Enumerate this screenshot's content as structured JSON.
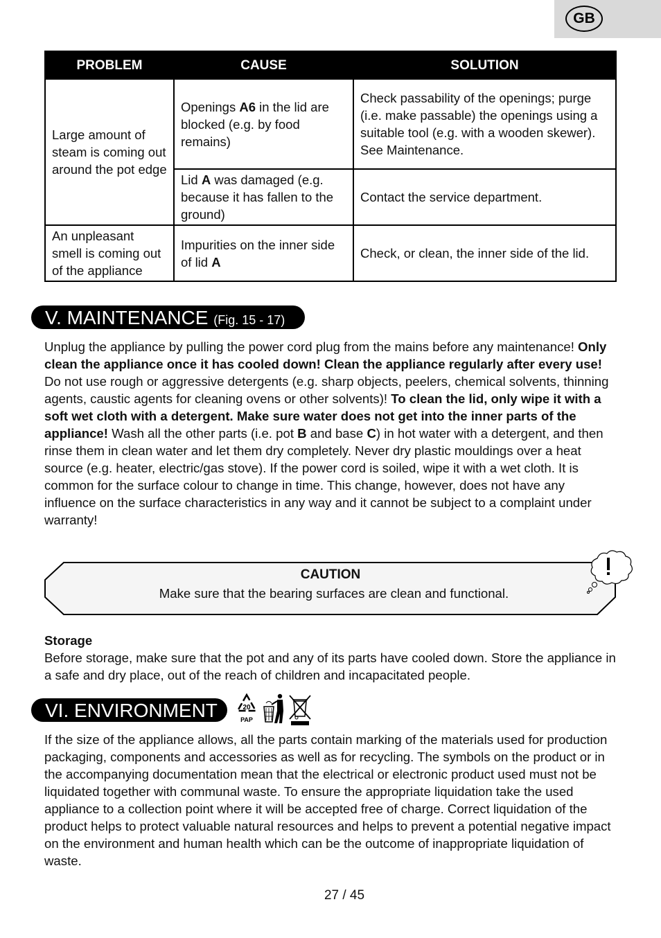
{
  "language_badge": "GB",
  "troubleshooting": {
    "headers": [
      "PROBLEM",
      "CAUSE",
      "SOLUTION"
    ],
    "rows": [
      {
        "problem": "Large amount of steam is coming out around the pot edge",
        "causes": [
          {
            "pre": "Openings ",
            "bold": "A6",
            "post": " in the lid are blocked (e.g. by food remains)",
            "solution": "Check passability of the openings; purge (i.e. make passable) the openings using a suitable tool (e.g. with a wooden skewer). See Maintenance."
          },
          {
            "pre": "Lid ",
            "bold": "A",
            "post": " was damaged (e.g. because it has fallen to the ground)",
            "solution": "Contact the service department."
          }
        ]
      },
      {
        "problem": "An unpleasant smell is coming out of the appliance",
        "causes": [
          {
            "pre": "Impurities on the inner side of lid ",
            "bold": "A",
            "post": "",
            "solution": "Check, or clean, the inner side of the lid."
          }
        ]
      }
    ]
  },
  "maintenance": {
    "heading": "V. MAINTENANCE",
    "figure_ref": "(Fig. 15 - 17)",
    "paragraph": [
      {
        "t": "Unplug the appliance by pulling the power cord plug from the mains before any maintenance! ",
        "b": false
      },
      {
        "t": "Only clean the appliance once it has cooled down! Clean the appliance regularly after every use!",
        "b": true
      },
      {
        "t": " Do not use rough or aggressive detergents (e.g. sharp objects, peelers, chemical solvents, thinning agents, caustic agents for cleaning ovens or other solvents)! ",
        "b": false
      },
      {
        "t": "To clean the lid, only wipe it with a soft wet cloth with a detergent. Make sure water does not get into the inner parts of the appliance!",
        "b": true
      },
      {
        "t": " Wash all the other parts (i.e. pot ",
        "b": false
      },
      {
        "t": "B",
        "b": true
      },
      {
        "t": " and base ",
        "b": false
      },
      {
        "t": "C",
        "b": true
      },
      {
        "t": ") in hot water with a detergent, and then rinse them in clean water and let them dry completely. Never dry plastic mouldings over a heat source (e.g. heater, electric/gas stove). If the power cord is soiled, wipe it with a wet cloth. It is common for the surface colour to change in time. This change, however, does not have any influence on the surface characteristics in any way and it cannot be subject to a complaint under warranty!",
        "b": false
      }
    ],
    "caution": {
      "title": "CAUTION",
      "text": "Make sure that the bearing surfaces are clean and functional.",
      "icon": "exclamation-thought-bubble-icon"
    },
    "storage": {
      "title": "Storage",
      "text": "Before storage, make sure that the pot and any of its parts have cooled down. Store the appliance in a safe and dry place, out of the reach of children and incapacitated people."
    }
  },
  "environment": {
    "heading": "VI. ENVIRONMENT",
    "icons": [
      {
        "name": "recycle-pap-20-icon",
        "label": "PAP",
        "number": "20"
      },
      {
        "name": "tidy-man-bin-icon"
      },
      {
        "name": "crossed-out-wheelie-bin-icon"
      }
    ],
    "paragraph": "If the size of the appliance allows, all the parts contain marking of the materials used for production packaging, components and accessories as well as for recycling. The symbols on the product or in the accompanying documentation mean that the electrical or electronic product used must not be liquidated together with communal waste. To ensure the appropriate liquidation take the used appliance to a collection point where it will be accepted free of charge. Correct liquidation of the product helps to protect valuable natural resources and helps to prevent a potential negative impact on the environment and human health which can be the outcome of inappropriate liquidation of waste."
  },
  "page_number": "27 / 45"
}
